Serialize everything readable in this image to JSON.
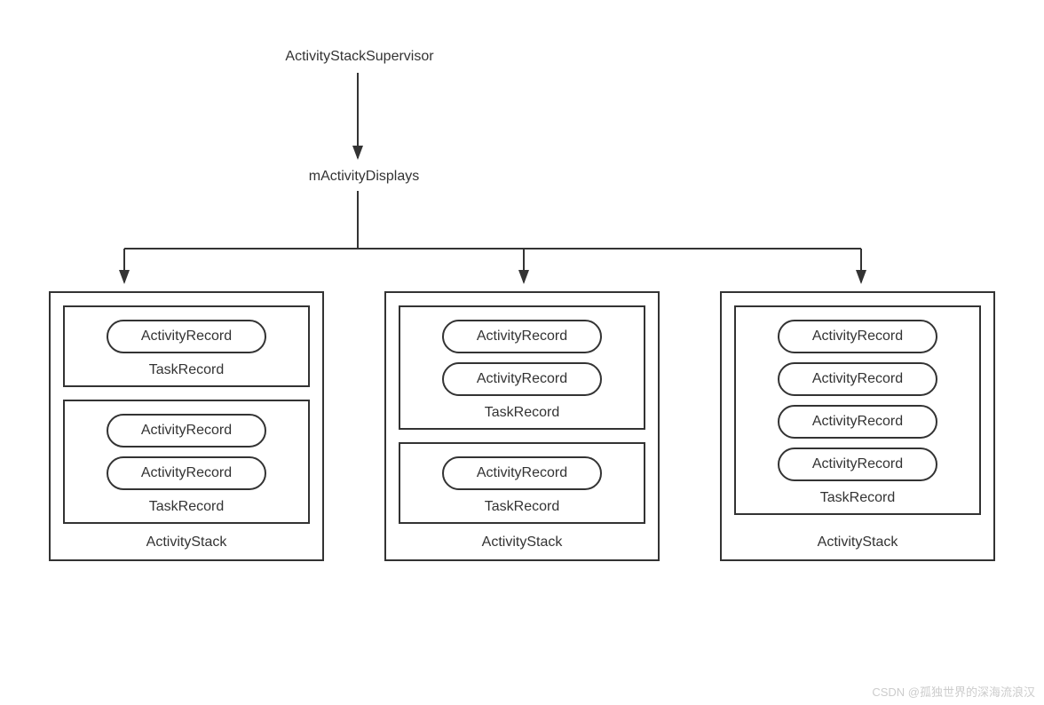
{
  "supervisor": "ActivityStackSupervisor",
  "displays": "mActivityDisplays",
  "activityStackLabel": "ActivityStack",
  "taskRecordLabel": "TaskRecord",
  "activityRecordLabel": "ActivityRecord",
  "stacks": [
    {
      "tasks": [
        {
          "records": [
            "ActivityRecord"
          ]
        },
        {
          "records": [
            "ActivityRecord",
            "ActivityRecord"
          ]
        }
      ]
    },
    {
      "tasks": [
        {
          "records": [
            "ActivityRecord",
            "ActivityRecord"
          ]
        },
        {
          "records": [
            "ActivityRecord"
          ]
        }
      ]
    },
    {
      "tasks": [
        {
          "records": [
            "ActivityRecord",
            "ActivityRecord",
            "ActivityRecord",
            "ActivityRecord"
          ]
        }
      ]
    }
  ],
  "watermark": "CSDN @孤独世界的深海流浪汉"
}
